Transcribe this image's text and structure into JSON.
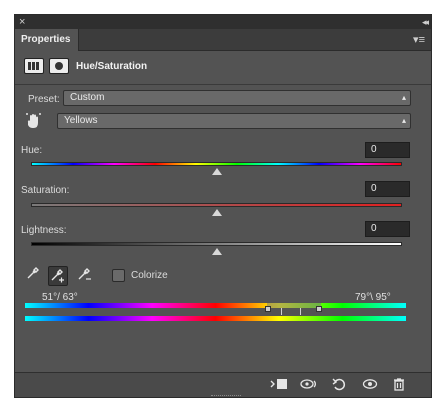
{
  "window": {
    "close_glyph": "×",
    "collapse_glyph": "◂◂"
  },
  "tab": {
    "label": "Properties",
    "menu_glyph": "▾≡"
  },
  "header": {
    "title": "Hue/Saturation",
    "adjustment_icon": "adjustment-layer-icon",
    "mask_icon": "mask-icon"
  },
  "preset": {
    "label": "Preset:",
    "value": "Custom"
  },
  "channel": {
    "value": "Yellows",
    "tool_icon": "targeted-adjustment-hand-icon"
  },
  "hue": {
    "label": "Hue:",
    "value": "0",
    "level_fraction": 0.5
  },
  "saturation": {
    "label": "Saturation:",
    "value": "0",
    "level_fraction": 0.5
  },
  "lightness": {
    "label": "Lightness:",
    "value": "0",
    "level_fraction": 0.5
  },
  "tools": {
    "eyedropper": "eyedropper-icon",
    "eyedropper_add": "eyedropper-plus-icon",
    "eyedropper_subtract": "eyedropper-minus-icon",
    "colorize_label": "Colorize",
    "colorize_checked": false
  },
  "range": {
    "left": "51°/ 63°",
    "right": "79°\\ 95°"
  },
  "footer": {
    "clip": "clip-to-layer-icon",
    "view_previous": "view-previous-state-icon",
    "reset": "reset-icon",
    "visibility": "visibility-eye-icon",
    "delete": "trash-icon"
  },
  "colors": {
    "panel_bg": "#535353",
    "tab_bar": "#3c3c3c",
    "titlebar": "#2f2f2f"
  }
}
